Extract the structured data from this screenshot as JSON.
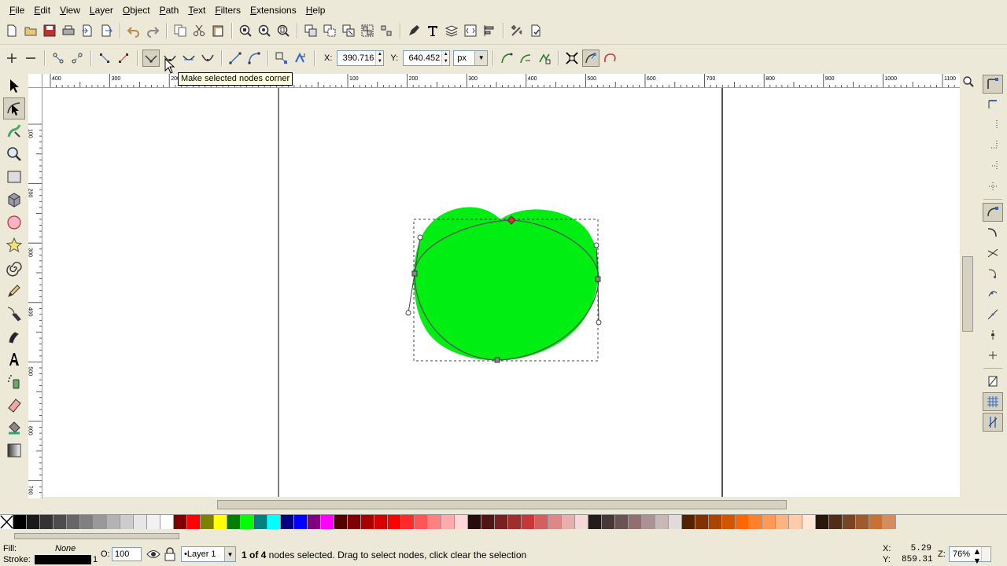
{
  "menu": [
    "File",
    "Edit",
    "View",
    "Layer",
    "Object",
    "Path",
    "Text",
    "Filters",
    "Extensions",
    "Help"
  ],
  "commands": [
    {
      "name": "new-document-icon"
    },
    {
      "name": "open-icon"
    },
    {
      "name": "save-icon"
    },
    {
      "name": "print-icon"
    },
    {
      "name": "import-icon"
    },
    {
      "name": "export-icon"
    },
    {
      "name": "undo-icon"
    },
    {
      "name": "redo-icon"
    },
    {
      "name": "copy-icon"
    },
    {
      "name": "cut-icon"
    },
    {
      "name": "paste-icon"
    },
    {
      "name": "zoom-selection-icon"
    },
    {
      "name": "zoom-drawing-icon"
    },
    {
      "name": "zoom-page-icon"
    },
    {
      "name": "duplicate-icon"
    },
    {
      "name": "clone-icon"
    },
    {
      "name": "unlink-clone-icon"
    },
    {
      "name": "group-icon"
    },
    {
      "name": "ungroup-icon"
    },
    {
      "name": "fill-stroke-icon"
    },
    {
      "name": "text-font-icon"
    },
    {
      "name": "layers-icon"
    },
    {
      "name": "xml-editor-icon"
    },
    {
      "name": "align-icon"
    },
    {
      "name": "preferences-icon"
    },
    {
      "name": "document-properties-icon"
    }
  ],
  "node_controls": {
    "x_label": "X:",
    "x_value": "390.716",
    "y_label": "Y:",
    "y_value": "640.452",
    "unit": "px"
  },
  "tooltip": "Make selected nodes corner",
  "ruler": {
    "h_labels": [
      "400",
      "300",
      "200",
      "100",
      "",
      "100",
      "200",
      "300",
      "400",
      "500",
      "600",
      "700",
      "800",
      "900",
      "1000",
      "1100"
    ],
    "v_labels": [
      "100",
      "200",
      "300",
      "400",
      "500",
      "600",
      "700",
      "800"
    ]
  },
  "palette": [
    "#000000",
    "#1a1a1a",
    "#333333",
    "#4d4d4d",
    "#666666",
    "#808080",
    "#999999",
    "#b3b3b3",
    "#cccccc",
    "#e6e6e6",
    "#f2f2f2",
    "#ffffff",
    "#800000",
    "#ff0000",
    "#808000",
    "#ffff00",
    "#008000",
    "#00ff00",
    "#008080",
    "#00ffff",
    "#000080",
    "#0000ff",
    "#800080",
    "#ff00ff",
    "#550000",
    "#800000",
    "#aa0000",
    "#d40000",
    "#ff0000",
    "#ff2a2a",
    "#ff5555",
    "#ff8080",
    "#ffaaaa",
    "#ffd5d5",
    "#280b0b",
    "#501616",
    "#782121",
    "#a02c2c",
    "#c83737",
    "#d35f5f",
    "#de8787",
    "#e9afaf",
    "#f4d7d7",
    "#241c1c",
    "#483737",
    "#6c5353",
    "#916f6f",
    "#ac9393",
    "#c8b7b7",
    "#e3dbdb",
    "#552200",
    "#803300",
    "#aa4400",
    "#d45500",
    "#ff6600",
    "#ff7f2a",
    "#ff9955",
    "#ffb380",
    "#ffccaa",
    "#ffe6d5",
    "#28170b",
    "#502d16",
    "#784421",
    "#a05a2c",
    "#c87137",
    "#d38d5f"
  ],
  "status": {
    "fill_label": "Fill:",
    "fill_value": "None",
    "stroke_label": "Stroke:",
    "stroke_width": "1",
    "opacity_label": "O:",
    "opacity_value": "100",
    "layer": "•Layer 1",
    "message_bold": "1 of 4",
    "message_rest": " nodes selected. Drag to select nodes, click clear the selection",
    "x_label": "X:",
    "x_value": "5.29",
    "y_label": "Y:",
    "y_value": "859.31",
    "zoom_label": "Z:",
    "zoom_value": "76%"
  },
  "colors": {
    "shape_fill": "#00ee11",
    "chrome": "#ece9d8",
    "selected_node": "#cc3333"
  }
}
